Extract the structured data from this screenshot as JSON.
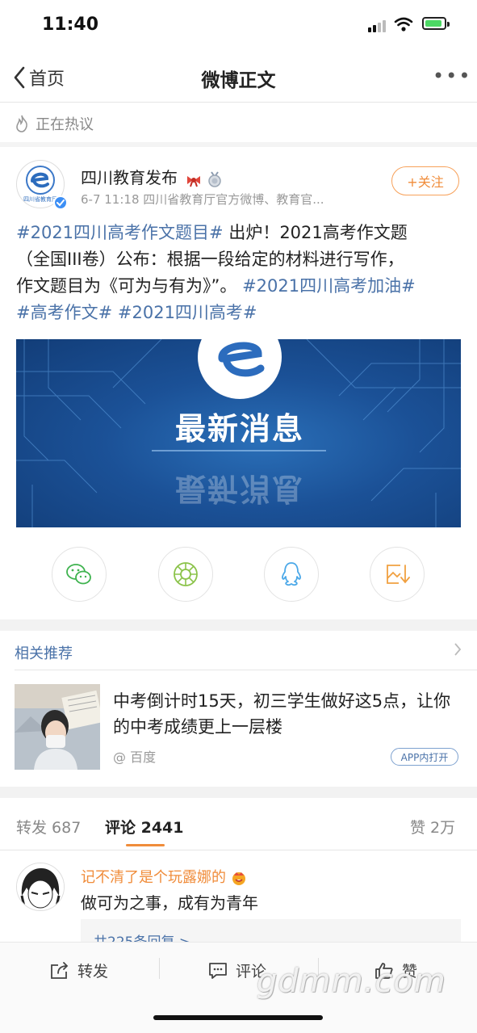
{
  "status_bar": {
    "time": "11:40"
  },
  "nav": {
    "back_label": "首页",
    "title": "微博正文",
    "more": "•••"
  },
  "hot_label": "正在热议",
  "post": {
    "author": "四川教育发布",
    "avatar_text": "四川省教育厅",
    "meta": "6-7 11:18  四川省教育厅官方微博、教育官...",
    "follow_label": "+关注",
    "line1_tag": "#2021四川高考作文题目#",
    "line1_text": " 出炉！2021高考作文题",
    "line2_text": "（全国III卷）公布：根据一段给定的材料进行写作，",
    "line3_text": "作文题目为《可为与有为》”。 ",
    "line3_tag": "#2021四川高考加油#",
    "line4_tag1": "#高考作文#",
    "line4_tag2": "#2021四川高考#",
    "banner_text": "最新消息"
  },
  "related": {
    "title": "相关推荐",
    "headline": "中考倒计时15天，初三学生做好这5点，让你的中考成绩更上一层楼",
    "source": "@ 百度",
    "app_label": "APP内打开"
  },
  "tabs": {
    "repost": "转发 687",
    "comment": "评论 2441",
    "like": "赞 2万"
  },
  "comment": {
    "name": "记不清了是个玩露娜的",
    "text": "做可为之事，成有为青年",
    "replies": "共225条回复 >"
  },
  "bottom_bar": {
    "repost": "转发",
    "comment": "评论",
    "like": "赞"
  },
  "watermark": "gdmm.com",
  "colors": {
    "link": "#4a72a8",
    "accent": "#f08c3a"
  }
}
